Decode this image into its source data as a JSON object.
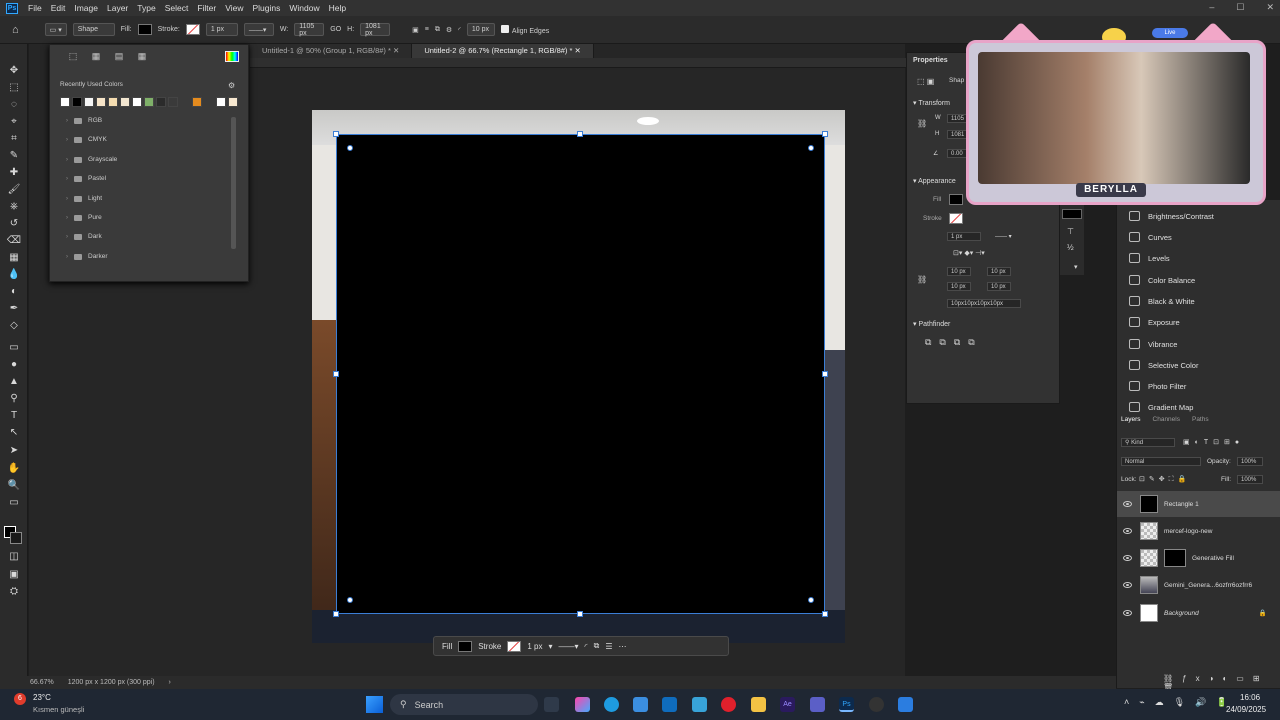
{
  "menubar": {
    "logo": "Ps",
    "items": [
      "File",
      "Edit",
      "Image",
      "Layer",
      "Type",
      "Select",
      "Filter",
      "View",
      "Plugins",
      "Window",
      "Help"
    ]
  },
  "options": {
    "shape_label": "Shape",
    "fill_label": "Fill:",
    "stroke_label": "Stroke:",
    "stroke_width": "1 px",
    "w_label": "W:",
    "w_value": "1105 px",
    "link_label": "GO",
    "h_label": "H:",
    "h_value": "1081 px",
    "radius": "10 px",
    "align_edges": "Align Edges"
  },
  "tabs": [
    {
      "label": "Untitled-1 @ 50% (Group 1, RGB/8#) *"
    },
    {
      "label": "Untitled-2 @ 66.7% (Rectangle 1, RGB/8#) *"
    }
  ],
  "swatches": {
    "recent_title": "Recently Used Colors",
    "colors": [
      "#ffffff",
      "#000000",
      "#f5f5f5",
      "#f6e4c8",
      "#f4dcb0",
      "#f2e6d0",
      "#ffffff",
      "#7fb069",
      "#2b2b2b",
      "#3a3a3a",
      "#e48b1e",
      "#ffffff",
      "#f8e8d0"
    ],
    "folders": [
      "RGB",
      "CMYK",
      "Grayscale",
      "Pastel",
      "Light",
      "Pure",
      "Dark",
      "Darker"
    ]
  },
  "properties": {
    "tab_title": "Properties",
    "shape_tab": "Shap",
    "transform": "Transform",
    "w": "1105",
    "h": "1081",
    "angle": "0.00",
    "appearance": "Appearance",
    "fill": "Fill",
    "stroke": "Stroke",
    "stroke_px": "1 px",
    "corner_tl": "10 px",
    "corner_tr": "10 px",
    "corner_bl": "10 px",
    "corner_br": "10 px",
    "corners_all": "10px10px10px10px",
    "pathfinder": "Pathfinder"
  },
  "adjustments": [
    "Brightness/Contrast",
    "Curves",
    "Levels",
    "Color Balance",
    "Black & White",
    "Exposure",
    "Vibrance",
    "Selective Color",
    "Photo Filter",
    "Gradient Map"
  ],
  "layers": {
    "tabs": [
      "Layers",
      "Channels",
      "Paths"
    ],
    "kind": "Kind",
    "blend": "Normal",
    "opacity_label": "Opacity:",
    "opacity": "100%",
    "lock_label": "Lock:",
    "fill_label": "Fill:",
    "fill": "100%",
    "rows": [
      "Rectangle 1",
      "mercef-logo-new",
      "Generative Fill",
      "Gemini_Genera...6ozfrr6ozfrr6",
      "Background"
    ]
  },
  "contextbar": {
    "fill": "Fill",
    "stroke": "Stroke",
    "stroke_px": "1 px"
  },
  "status": {
    "zoom": "66.67%",
    "doc_info": "1200 px x 1200 px (300 ppi)"
  },
  "webcam": {
    "name": "BERYLLA",
    "badge": "Live"
  },
  "taskbar": {
    "weather_temp": "23°C",
    "weather_desc": "Kısmen güneşli",
    "search": "Search",
    "time": "16:06",
    "date": "24/09/2025"
  }
}
